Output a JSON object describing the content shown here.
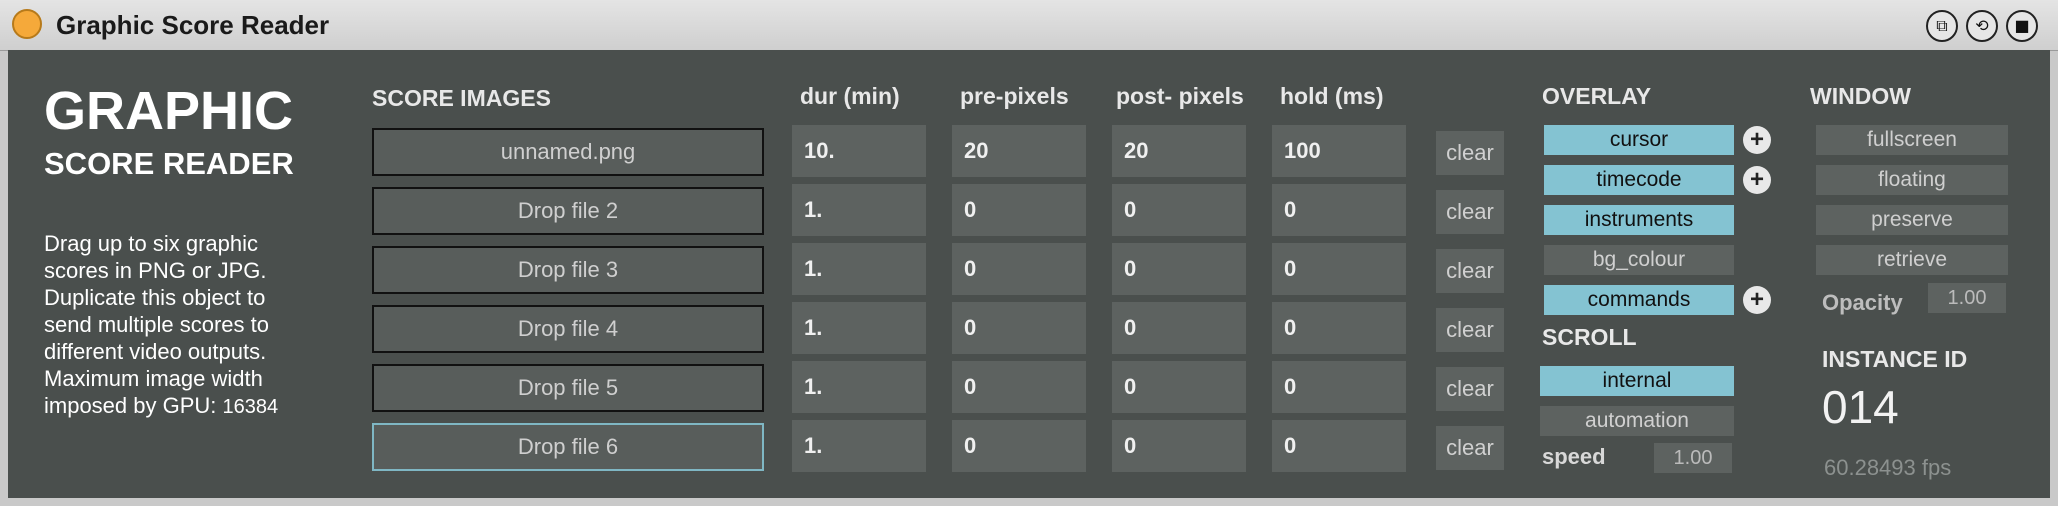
{
  "window": {
    "title": "Graphic Score Reader"
  },
  "branding": {
    "line1": "GRAPHIC",
    "line2": "SCORE READER"
  },
  "description": [
    "Drag up to six graphic",
    "scores in PNG or JPG.",
    "Duplicate this object to",
    "send multiple scores to",
    "different video outputs.",
    "Maximum image width",
    "imposed by GPU:"
  ],
  "gpu_max_width": "16384",
  "headers": {
    "score_images": "SCORE IMAGES",
    "dur": "dur (min)",
    "pre": "pre-pixels",
    "post": "post- pixels",
    "hold": "hold (ms)",
    "overlay": "OVERLAY",
    "scroll": "SCROLL",
    "window": "WINDOW"
  },
  "rows": [
    {
      "file": "unnamed.png",
      "dur": "10.",
      "pre": "20",
      "post": "20",
      "hold": "100",
      "clear": "clear"
    },
    {
      "file": "Drop file 2",
      "dur": "1.",
      "pre": "0",
      "post": "0",
      "hold": "0",
      "clear": "clear"
    },
    {
      "file": "Drop file 3",
      "dur": "1.",
      "pre": "0",
      "post": "0",
      "hold": "0",
      "clear": "clear"
    },
    {
      "file": "Drop file 4",
      "dur": "1.",
      "pre": "0",
      "post": "0",
      "hold": "0",
      "clear": "clear"
    },
    {
      "file": "Drop file 5",
      "dur": "1.",
      "pre": "0",
      "post": "0",
      "hold": "0",
      "clear": "clear"
    },
    {
      "file": "Drop file 6",
      "dur": "1.",
      "pre": "0",
      "post": "0",
      "hold": "0",
      "clear": "clear"
    }
  ],
  "overlay": [
    {
      "label": "cursor",
      "on": true,
      "plus": "+"
    },
    {
      "label": "timecode",
      "on": true,
      "plus": "+"
    },
    {
      "label": "instruments",
      "on": true
    },
    {
      "label": "bg_colour",
      "on": false
    },
    {
      "label": "commands",
      "on": true,
      "plus": "+"
    }
  ],
  "scroll": {
    "internal": "internal",
    "automation": "automation",
    "speed_label": "speed",
    "speed_value": "1.00"
  },
  "window_opts": {
    "fullscreen": "fullscreen",
    "floating": "floating",
    "preserve": "preserve",
    "retrieve": "retrieve",
    "opacity_label": "Opacity",
    "opacity_value": "1.00"
  },
  "instance": {
    "label": "INSTANCE ID",
    "id": "014",
    "fps": "60.28493 fps"
  },
  "colors": {
    "panel": "#4a4f4d",
    "accent": "#84c3d2",
    "title_dot": "#f5a93a"
  },
  "titlebar_icons": [
    "float-window-icon",
    "refresh-icon",
    "save-icon"
  ]
}
